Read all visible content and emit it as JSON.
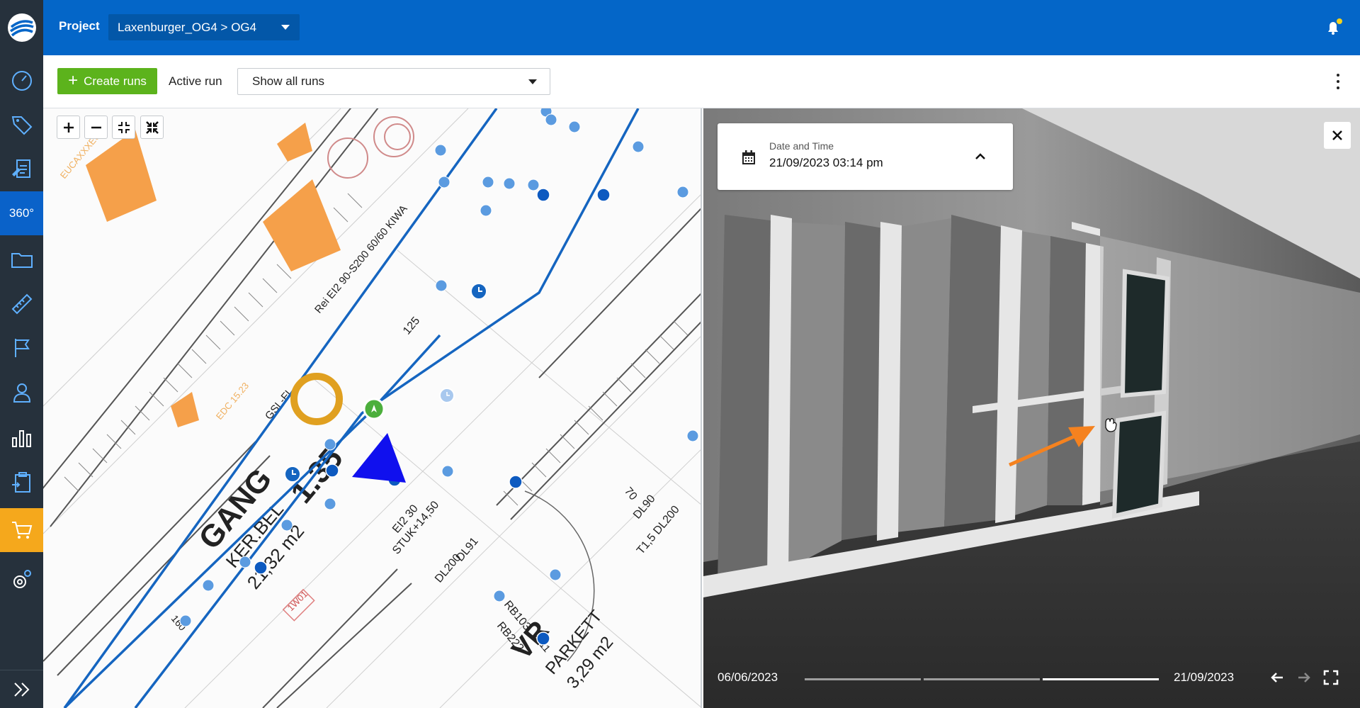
{
  "topbar": {
    "project_label": "Project",
    "project_value": "Laxenburger_OG4 > OG4"
  },
  "toolbar": {
    "create_label": "Create runs",
    "active_run_label": "Active run",
    "runs_select_value": "Show all runs"
  },
  "sidebar": {
    "items": [
      {
        "name": "dashboard",
        "icon": "gauge-icon"
      },
      {
        "name": "tags",
        "icon": "tag-icon"
      },
      {
        "name": "reports",
        "icon": "report-icon"
      },
      {
        "name": "360",
        "label": "360°",
        "active": true
      },
      {
        "name": "files",
        "icon": "folder-icon"
      },
      {
        "name": "measure",
        "icon": "ruler-icon"
      },
      {
        "name": "milestones",
        "icon": "flag-icon"
      },
      {
        "name": "users",
        "icon": "user-icon"
      },
      {
        "name": "analytics",
        "icon": "bar-chart-icon"
      },
      {
        "name": "tasks",
        "icon": "clipboard-icon"
      },
      {
        "name": "cart",
        "icon": "cart-icon",
        "highlight": "#f5a81c"
      },
      {
        "name": "settings",
        "icon": "gear-icon"
      },
      {
        "name": "expand",
        "icon": "double-chevron-right-icon"
      }
    ]
  },
  "map": {
    "labels": {
      "room1": "GANG",
      "room1_num": "1.35",
      "room1_sub": "KER.BEL",
      "room1_area": "21,32 m2",
      "room2": "VR",
      "room2_sub": "PARKETT",
      "room2_area": "3,29 m2",
      "annot1": "EI2 30",
      "annot2": "STUK+14,50",
      "annot3": "DL90",
      "annot4": "T1,5 DL200",
      "annot5": "RB103",
      "annot6": "RB222",
      "annot7": "125",
      "annot8": "Rei EI2 90-S200 60/60 KIWA",
      "annot9": "GSL-FL",
      "annot10": "DL91",
      "annot11": "DL200",
      "annot12": "70",
      "annot13": "1311",
      "annot14": "1W01",
      "annot15": "160"
    }
  },
  "viewer": {
    "datetime_label": "Date and Time",
    "datetime_value": "21/09/2023 03:14 pm",
    "timeline_start": "06/06/2023",
    "timeline_end": "21/09/2023"
  },
  "colors": {
    "brand_blue": "#0466c8",
    "sidebar_bg": "#26313c",
    "create_green": "#5cb31c",
    "cart_orange": "#f5a81c",
    "run_line": "#1565c0",
    "arrow_orange": "#f5821f"
  }
}
